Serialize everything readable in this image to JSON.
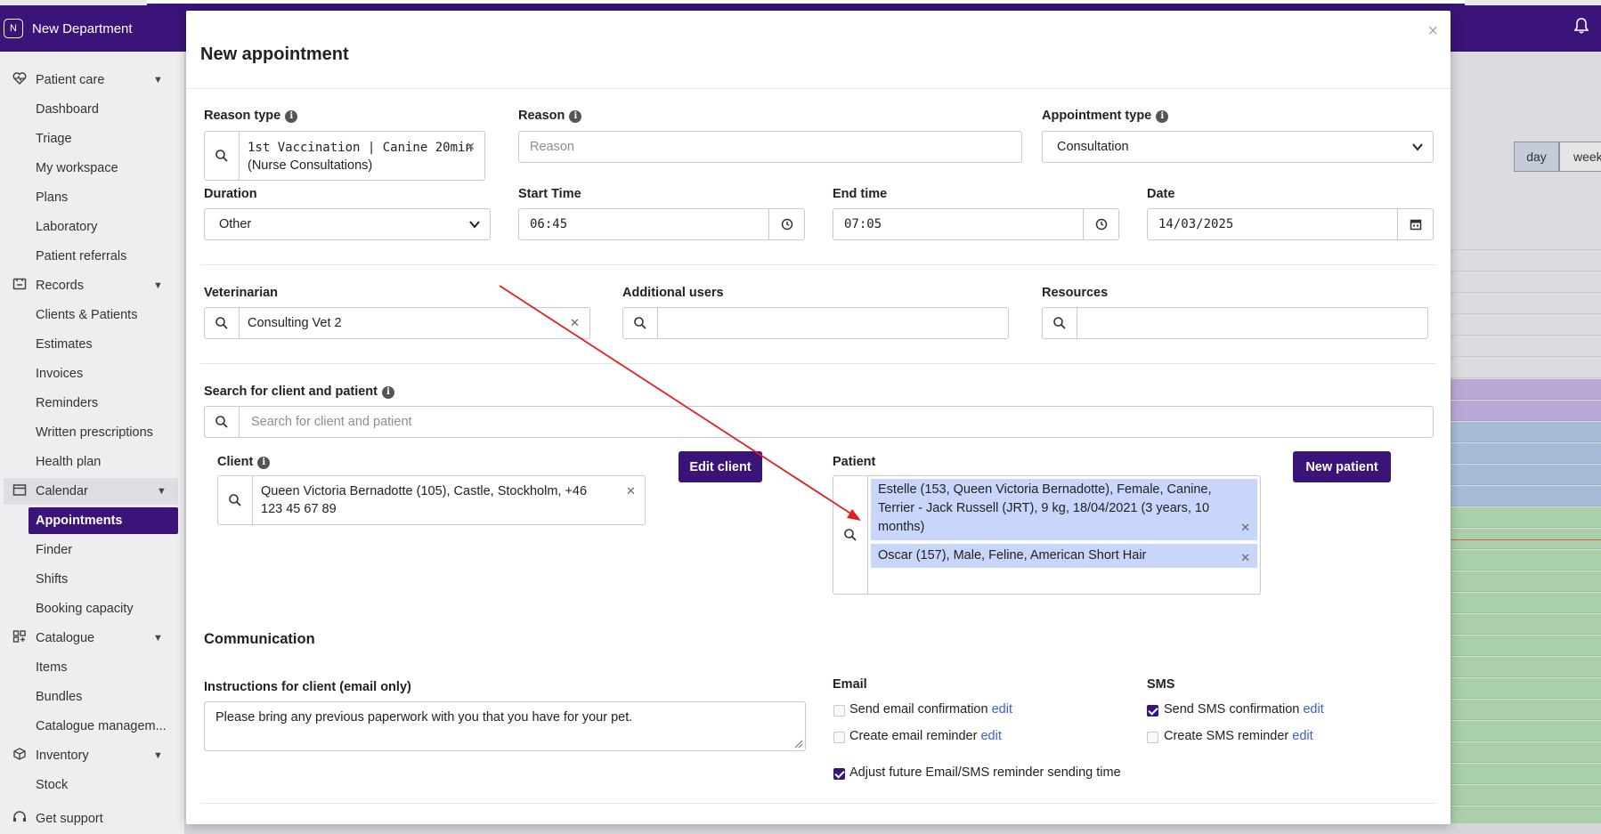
{
  "app": {
    "department_badge": "N",
    "department": "New Department"
  },
  "sidebar": {
    "sections": [
      {
        "key": "patient_care",
        "label": "Patient care",
        "icon": "heart-pulse-icon"
      },
      {
        "key": "records",
        "label": "Records",
        "icon": "folder-icon"
      },
      {
        "key": "calendar",
        "label": "Calendar",
        "icon": "calendar-icon"
      },
      {
        "key": "catalogue",
        "label": "Catalogue",
        "icon": "grid-plus-icon"
      },
      {
        "key": "inventory",
        "label": "Inventory",
        "icon": "box-icon"
      }
    ],
    "patient_care_items": [
      "Dashboard",
      "Triage",
      "My workspace",
      "Plans",
      "Laboratory",
      "Patient referrals"
    ],
    "records_items": [
      "Clients & Patients",
      "Estimates",
      "Invoices",
      "Reminders",
      "Written prescriptions",
      "Health plan"
    ],
    "calendar_items": [
      "Appointments",
      "Finder",
      "Shifts",
      "Booking capacity"
    ],
    "catalogue_items": [
      "Items",
      "Bundles",
      "Catalogue managem..."
    ],
    "inventory_items": [
      "Stock"
    ],
    "get_support": "Get support",
    "active_item": "Appointments"
  },
  "calendar": {
    "tab_day": "day",
    "tab_week": "week",
    "colors": {
      "purple": "#b9a8d6",
      "blue": "#a6bcd6",
      "green": "#a9d0ab",
      "red_line": "#e05a5a"
    }
  },
  "modal": {
    "title": "New appointment",
    "close": "×",
    "reason_type": {
      "label": "Reason type",
      "value_line1": "1st Vaccination | Canine 20min",
      "value_line2": "(Nurse Consultations)"
    },
    "reason": {
      "label": "Reason",
      "placeholder": "Reason"
    },
    "appointment_type": {
      "label": "Appointment type",
      "value": "Consultation"
    },
    "duration": {
      "label": "Duration",
      "value": "Other"
    },
    "start_time": {
      "label": "Start Time",
      "value": "06:45"
    },
    "end_time": {
      "label": "End time",
      "value": "07:05"
    },
    "date": {
      "label": "Date",
      "value": "14/03/2025"
    },
    "veterinarian": {
      "label": "Veterinarian",
      "value": "Consulting Vet 2"
    },
    "additional_users": {
      "label": "Additional users",
      "value": ""
    },
    "resources": {
      "label": "Resources",
      "value": ""
    },
    "search_client_patient": {
      "label": "Search for client and patient",
      "placeholder": "Search for client and patient"
    },
    "client": {
      "label": "Client",
      "value_line1": "Queen Victoria Bernadotte (105), Castle, Stockholm, +46",
      "value_line2": "123 45 67 89",
      "edit_button": "Edit client"
    },
    "patient": {
      "label": "Patient",
      "new_button": "New patient",
      "chips": [
        {
          "lines": [
            "Estelle (153, Queen Victoria Bernadotte), Female, Canine,",
            "Terrier - Jack Russell (JRT), 9 kg, 18/04/2021 (3 years, 10",
            "months)"
          ]
        },
        {
          "lines": [
            "Oscar (157), Male, Feline, American Short Hair"
          ]
        }
      ]
    },
    "communication": {
      "title": "Communication",
      "instructions_label": "Instructions for client (email only)",
      "instructions_value": "Please bring any previous paperwork with you that you have for your pet.",
      "email_header": "Email",
      "sms_header": "SMS",
      "edit_label": "edit",
      "send_email_confirmation": {
        "label": "Send email confirmation",
        "checked": false
      },
      "create_email_reminder": {
        "label": "Create email reminder",
        "checked": false
      },
      "send_sms_confirmation": {
        "label": "Send SMS confirmation",
        "checked": true
      },
      "create_sms_reminder": {
        "label": "Create SMS reminder",
        "checked": false
      },
      "adjust_future": {
        "label": "Adjust future Email/SMS reminder sending time",
        "checked": true
      }
    }
  },
  "annotation": {
    "color": "#e02020"
  }
}
